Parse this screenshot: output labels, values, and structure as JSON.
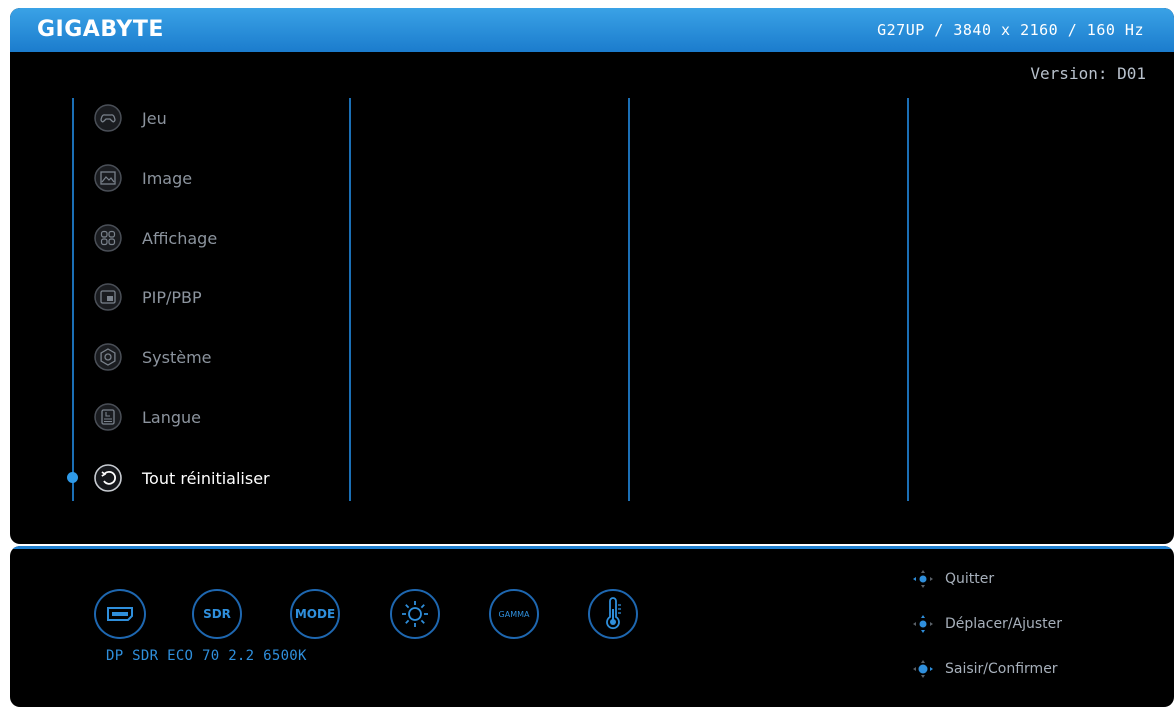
{
  "header": {
    "brand": "GIGABYTE",
    "model_info": "G27UP  /  3840 x 2160 / 160 Hz"
  },
  "version": "Version: D01",
  "menu": {
    "items": [
      {
        "label": "Jeu",
        "icon": "gamepad-icon"
      },
      {
        "label": "Image",
        "icon": "picture-icon"
      },
      {
        "label": "Affichage",
        "icon": "display-grid-icon"
      },
      {
        "label": "PIP/PBP",
        "icon": "pip-icon"
      },
      {
        "label": "Système",
        "icon": "settings-gear-icon"
      },
      {
        "label": "Langue",
        "icon": "language-icon"
      },
      {
        "label": "Tout réinitialiser",
        "icon": "reset-icon"
      }
    ],
    "selected": "Tout réinitialiser"
  },
  "quick_bar": {
    "input_icon": "displayport-icon",
    "sdr_label": "SDR",
    "mode_label": "MODE",
    "brightness_icon": "brightness-icon",
    "gamma_label": "GAMMA",
    "temperature_icon": "thermometer-icon",
    "status": "DP SDR ECO 70 2.2 6500K"
  },
  "hints": [
    {
      "label": "Quitter",
      "icon": "joystick-exit-icon"
    },
    {
      "label": "Déplacer/Ajuster",
      "icon": "joystick-move-icon"
    },
    {
      "label": "Saisir/Confirmer",
      "icon": "joystick-press-icon"
    }
  ],
  "colors": {
    "accent": "#1f7fcf",
    "header_gradient_top": "#3aa2e6",
    "background": "#000000",
    "inactive_text": "#8c949e"
  }
}
